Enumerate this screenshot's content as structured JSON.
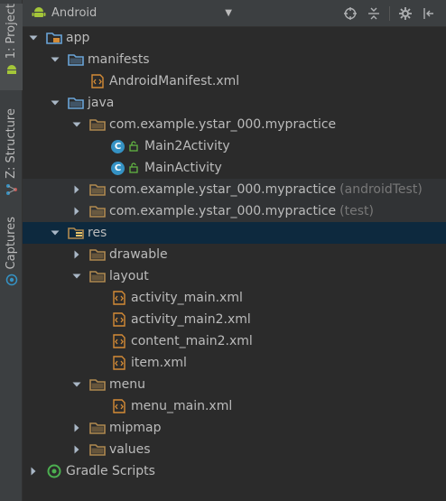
{
  "toolbar": {
    "view_mode": "Android"
  },
  "side_tabs": {
    "project": "1: Project",
    "structure": "Z: Structure",
    "captures": "Captures"
  },
  "tree": {
    "app": "app",
    "manifests": "manifests",
    "android_manifest": "AndroidManifest.xml",
    "java": "java",
    "pkg_main": "com.example.ystar_000.mypractice",
    "main2_activity": "Main2Activity",
    "main_activity": "MainActivity",
    "pkg_android_test": "com.example.ystar_000.mypractice",
    "pkg_android_test_suffix": "(androidTest)",
    "pkg_test": "com.example.ystar_000.mypractice",
    "pkg_test_suffix": "(test)",
    "res": "res",
    "drawable": "drawable",
    "layout": "layout",
    "activity_main_xml": "activity_main.xml",
    "activity_main2_xml": "activity_main2.xml",
    "content_main2_xml": "content_main2.xml",
    "item_xml": "item.xml",
    "menu": "menu",
    "menu_main_xml": "menu_main.xml",
    "mipmap": "mipmap",
    "values": "values",
    "gradle_scripts": "Gradle Scripts"
  },
  "colors": {
    "background": "#2b2b2b",
    "panel": "#3c3f41",
    "selection": "#0d293e",
    "text": "#bbbbbb",
    "muted_text": "#787878",
    "class_badge": "#3592c4",
    "folder_blue": "#6aa4d8",
    "folder_brown": "#b0894f",
    "xml_orange": "#d48b36",
    "android_green": "#a4c639"
  }
}
